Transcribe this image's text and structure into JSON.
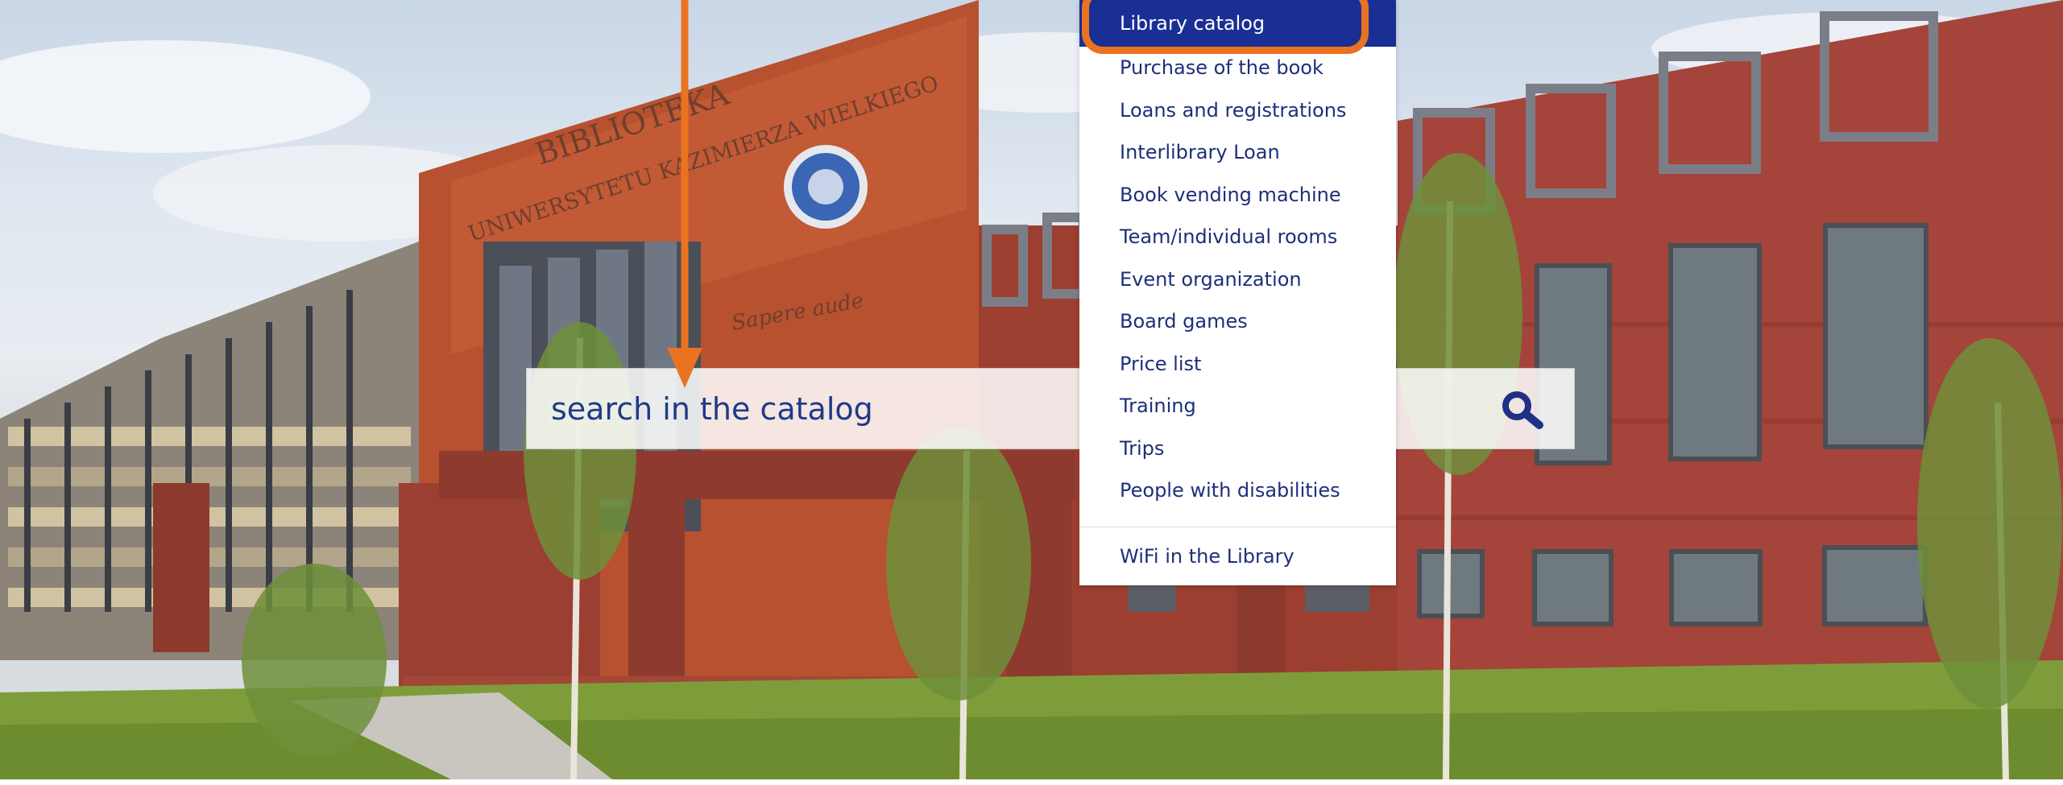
{
  "hero": {
    "building_sign_line1": "BIBLIOTEKA",
    "building_sign_line2": "UNIWERSYTETU KAZIMIERZA WIELKIEGO",
    "building_motto": "Sapere aude"
  },
  "search": {
    "placeholder": "search in the catalog",
    "button_icon": "search-icon"
  },
  "menu": {
    "items": [
      {
        "label": "Library catalog"
      },
      {
        "label": "Purchase of the book"
      },
      {
        "label": "Loans and registrations"
      },
      {
        "label": "Interlibrary Loan"
      },
      {
        "label": "Book vending machine"
      },
      {
        "label": "Team/individual rooms"
      },
      {
        "label": "Event organization"
      },
      {
        "label": "Board games"
      },
      {
        "label": "Price list"
      },
      {
        "label": "Training"
      },
      {
        "label": "Trips"
      },
      {
        "label": "People with disabilities"
      }
    ],
    "footer_item": {
      "label": "WiFi in the Library"
    }
  },
  "colors": {
    "accent_orange": "#ea7321",
    "menu_active_bg": "#1a2f94",
    "menu_text": "#1e2f7a",
    "search_text": "#1e3a8a"
  },
  "annotations": {
    "highlight_target": "Library catalog",
    "arrow_target": "search in the catalog"
  }
}
